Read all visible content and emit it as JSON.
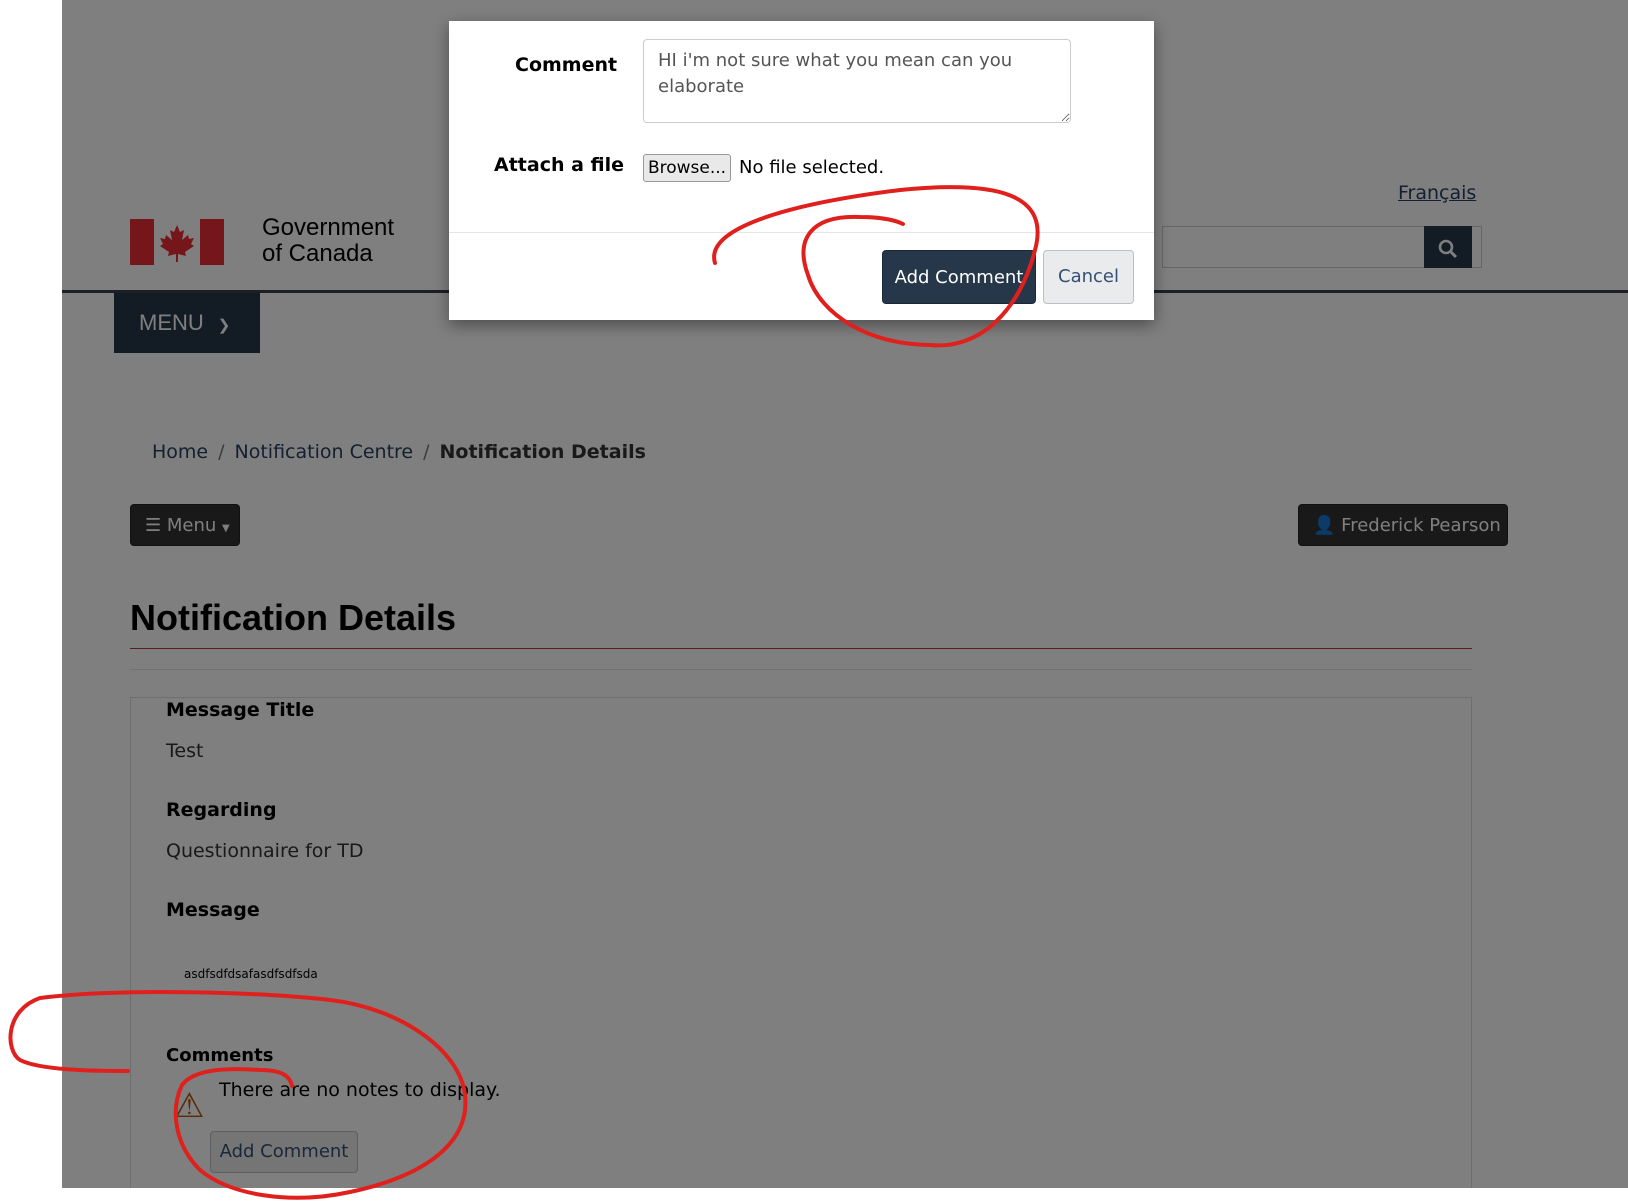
{
  "header": {
    "language_link": "Français",
    "gov_line1": "Government",
    "gov_line2": "of Canada",
    "menu_label": "MENU",
    "search_icon": "search-icon"
  },
  "breadcrumb": {
    "home": "Home",
    "separator": "/",
    "notification_centre": "Notification Centre",
    "current": "Notification Details"
  },
  "toolbar": {
    "menu_label": "Menu",
    "user_name": "Frederick Pearson"
  },
  "page": {
    "title": "Notification Details"
  },
  "details": {
    "message_title_label": "Message Title",
    "message_title_value": "Test",
    "regarding_label": "Regarding",
    "regarding_value": "Questionnaire for TD",
    "message_label": "Message",
    "message_value": "asdfsdfdsafasdfsdfsda",
    "comments_label": "Comments",
    "no_notes": "There are no notes to display.",
    "add_comment_label": "Add Comment"
  },
  "modal": {
    "comment_label": "Comment",
    "comment_value": "HI i'm not sure what you mean can you elaborate",
    "attach_label": "Attach a file",
    "browse_label": "Browse...",
    "no_file": "No file selected.",
    "add_comment_label": "Add Comment",
    "cancel_label": "Cancel"
  },
  "colors": {
    "brand_dark": "#26374a",
    "link": "#284162",
    "flag_red": "#eb2d37",
    "annotation_red": "#e0201c",
    "title_rule": "#af3c43"
  }
}
